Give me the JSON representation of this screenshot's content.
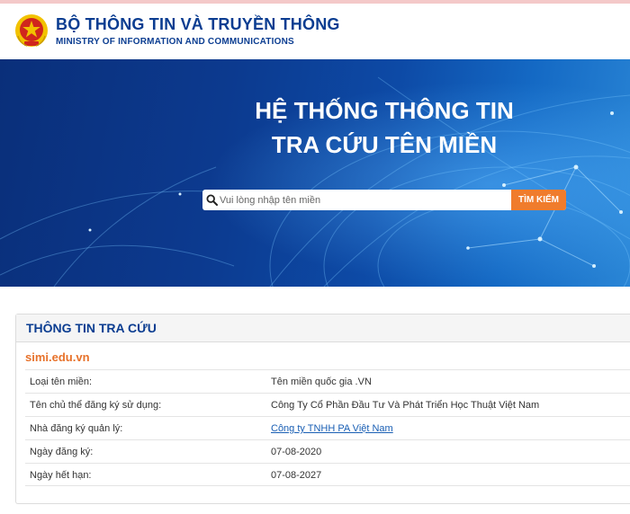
{
  "header": {
    "org_title": "BỘ THÔNG TIN VÀ TRUYỀN THÔNG",
    "org_subtitle": "MINISTRY OF INFORMATION AND COMMUNICATIONS"
  },
  "banner": {
    "title_line1": "HỆ THỐNG THÔNG TIN",
    "title_line2": "TRA CỨU TÊN MIỀN"
  },
  "search": {
    "placeholder": "Vui lòng nhập tên miền",
    "button_label": "TÌM KIẾM"
  },
  "result": {
    "panel_title": "THÔNG TIN TRA CỨU",
    "domain": "simi.edu.vn",
    "rows": [
      {
        "label": "Loại tên miền:",
        "value": "Tên miền quốc gia .VN"
      },
      {
        "label": "Tên chủ thể đăng ký sử dụng:",
        "value": "Công Ty Cổ Phần Đầu Tư Và Phát Triển Học Thuật Việt Nam"
      },
      {
        "label": "Nhà đăng ký quản lý:",
        "value": "Công ty TNHH PA Việt Nam"
      },
      {
        "label": "Ngày đăng ký:",
        "value": "07-08-2020"
      },
      {
        "label": "Ngày hết hạn:",
        "value": "07-08-2027"
      }
    ]
  },
  "colors": {
    "brand_blue": "#0b3d91",
    "accent_orange": "#f07c2c",
    "link_blue": "#1a5fb4",
    "emblem_red": "#d0261d",
    "emblem_gold": "#f2c200"
  },
  "icons": {
    "emblem": "national-emblem-icon",
    "search": "search-icon"
  }
}
